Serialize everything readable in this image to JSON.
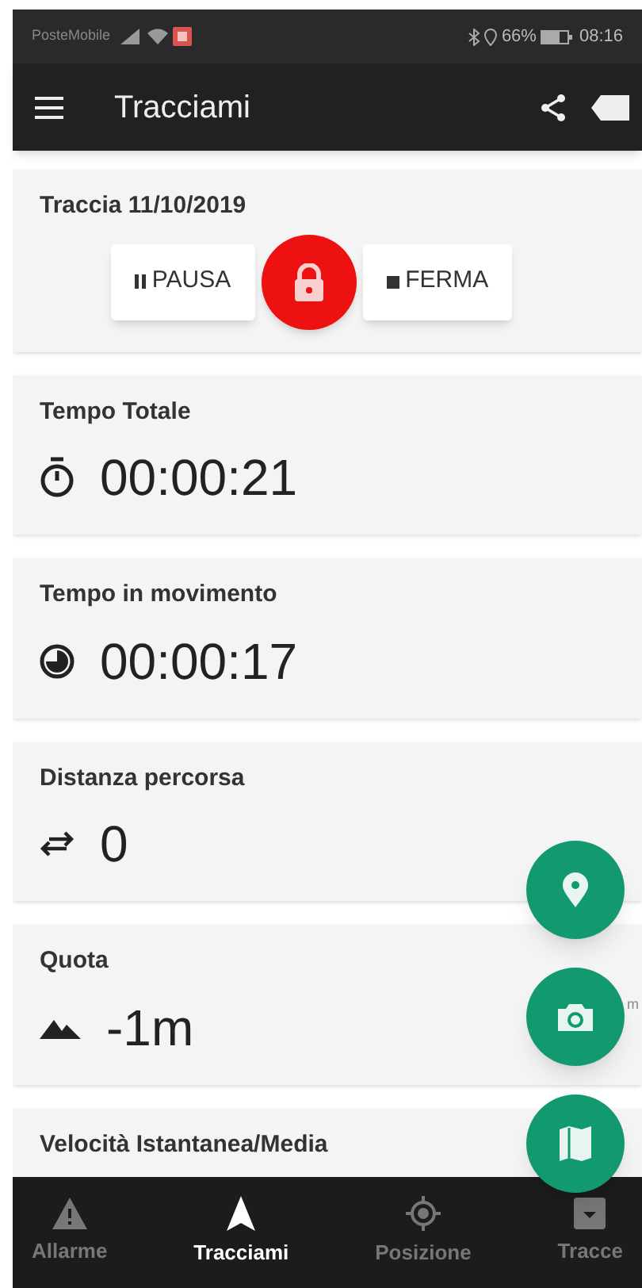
{
  "status_bar": {
    "carrier": "PosteMobile",
    "battery": "66%",
    "time": "08:16"
  },
  "app_bar": {
    "title": "Tracciami"
  },
  "track": {
    "title": "Traccia 11/10/2019",
    "buttons": [
      {
        "kind": "pause",
        "label": "PAUSA"
      },
      {
        "kind": "lock"
      },
      {
        "kind": "stop",
        "label": "FERMA"
      }
    ]
  },
  "stats": [
    {
      "kind": "timer",
      "label": "Tempo Totale",
      "value": "00:00:21"
    },
    {
      "kind": "moving",
      "label": "Tempo in movimento",
      "value": "00:00:17"
    },
    {
      "kind": "distance",
      "label": "Distanza percorsa",
      "value": "0"
    },
    {
      "kind": "altitude",
      "label": "Quota",
      "value": "-1m",
      "note": "m"
    },
    {
      "label": "Velocità Istantanea/Media"
    }
  ],
  "fabs": [
    {
      "kind": "pin"
    },
    {
      "kind": "camera"
    },
    {
      "kind": "map"
    }
  ],
  "nav": [
    {
      "kind": "alarm",
      "label": "Allarme",
      "selected": false
    },
    {
      "kind": "track",
      "label": "Tracciami",
      "selected": true
    },
    {
      "kind": "position",
      "label": "Posizione",
      "selected": false
    },
    {
      "kind": "tracks",
      "label": "Tracce",
      "selected": false
    }
  ]
}
